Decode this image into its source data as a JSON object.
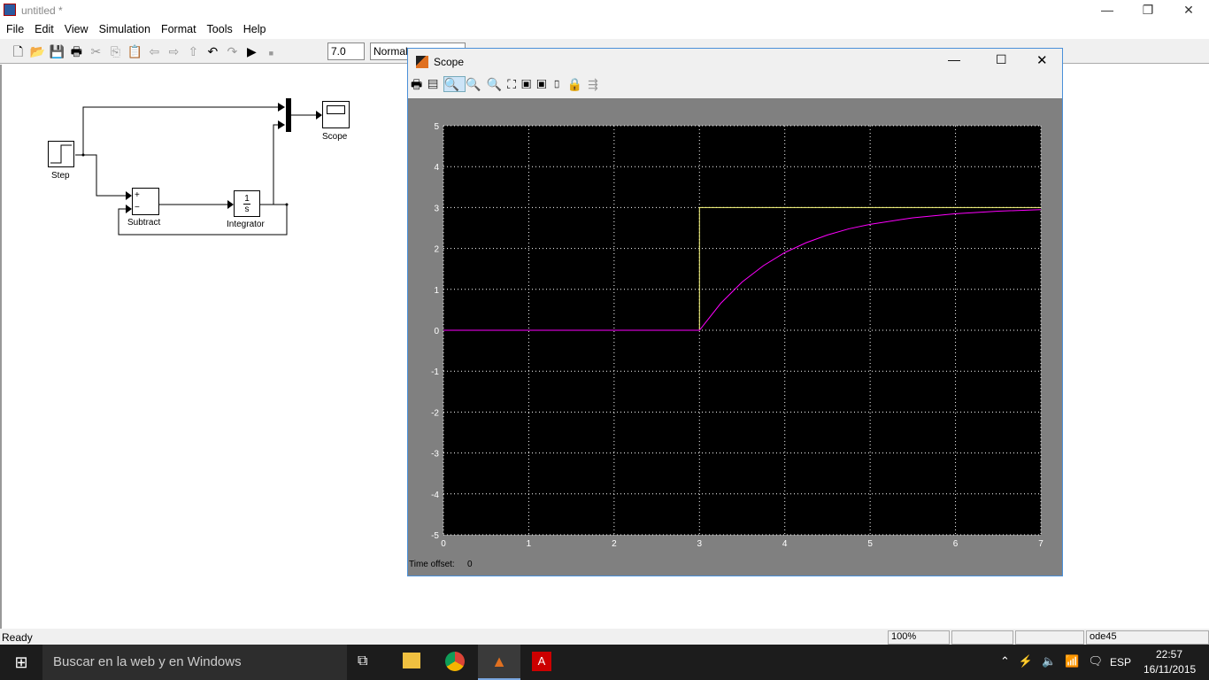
{
  "window": {
    "title": "untitled *",
    "menu": [
      "File",
      "Edit",
      "View",
      "Simulation",
      "Format",
      "Tools",
      "Help"
    ],
    "toolbar": {
      "icons": [
        "new-icon",
        "open-icon",
        "save-icon",
        "print-icon",
        "cut-icon",
        "copy-icon",
        "paste-icon",
        "back-icon",
        "forward-icon",
        "up-icon",
        "undo-icon",
        "redo-icon",
        "play-icon",
        "stop-icon"
      ],
      "stop_time": "7.0",
      "sim_mode": "Normal"
    }
  },
  "diagram": {
    "blocks": {
      "step": "Step",
      "subtract": "Subtract",
      "integrator": "Integrator",
      "integrator_num": "1",
      "integrator_den": "s",
      "scope": "Scope",
      "plus": "+",
      "minus": "−"
    }
  },
  "status": {
    "text": "Ready",
    "zoom": "100%",
    "solver": "ode45"
  },
  "scope": {
    "title": "Scope",
    "time_offset_label": "Time offset:",
    "time_offset": "0"
  },
  "taskbar": {
    "search": "Buscar en la web y en Windows",
    "lang": "ESP",
    "time": "22:57",
    "date": "16/11/2015"
  },
  "chart_data": {
    "type": "line",
    "xlim": [
      0,
      7
    ],
    "ylim": [
      -5,
      5
    ],
    "grid": true,
    "xticks": [
      "0",
      "1",
      "2",
      "3",
      "4",
      "5",
      "6",
      "7"
    ],
    "yticks": [
      "5",
      "4",
      "3",
      "2",
      "1",
      "0",
      "-1",
      "-2",
      "-3",
      "-4",
      "-5"
    ],
    "background": "#000000",
    "series": [
      {
        "color": "#ffff80",
        "x": [
          0,
          3,
          3,
          7
        ],
        "y": [
          0,
          0,
          3,
          3
        ]
      },
      {
        "color": "#ff00ff",
        "x": [
          0,
          3,
          3.25,
          3.5,
          3.75,
          4,
          4.25,
          4.5,
          4.75,
          5,
          5.5,
          6,
          6.5,
          7
        ],
        "y": [
          0,
          0,
          0.66,
          1.18,
          1.58,
          1.9,
          2.14,
          2.33,
          2.48,
          2.59,
          2.75,
          2.85,
          2.91,
          2.95
        ]
      }
    ]
  }
}
